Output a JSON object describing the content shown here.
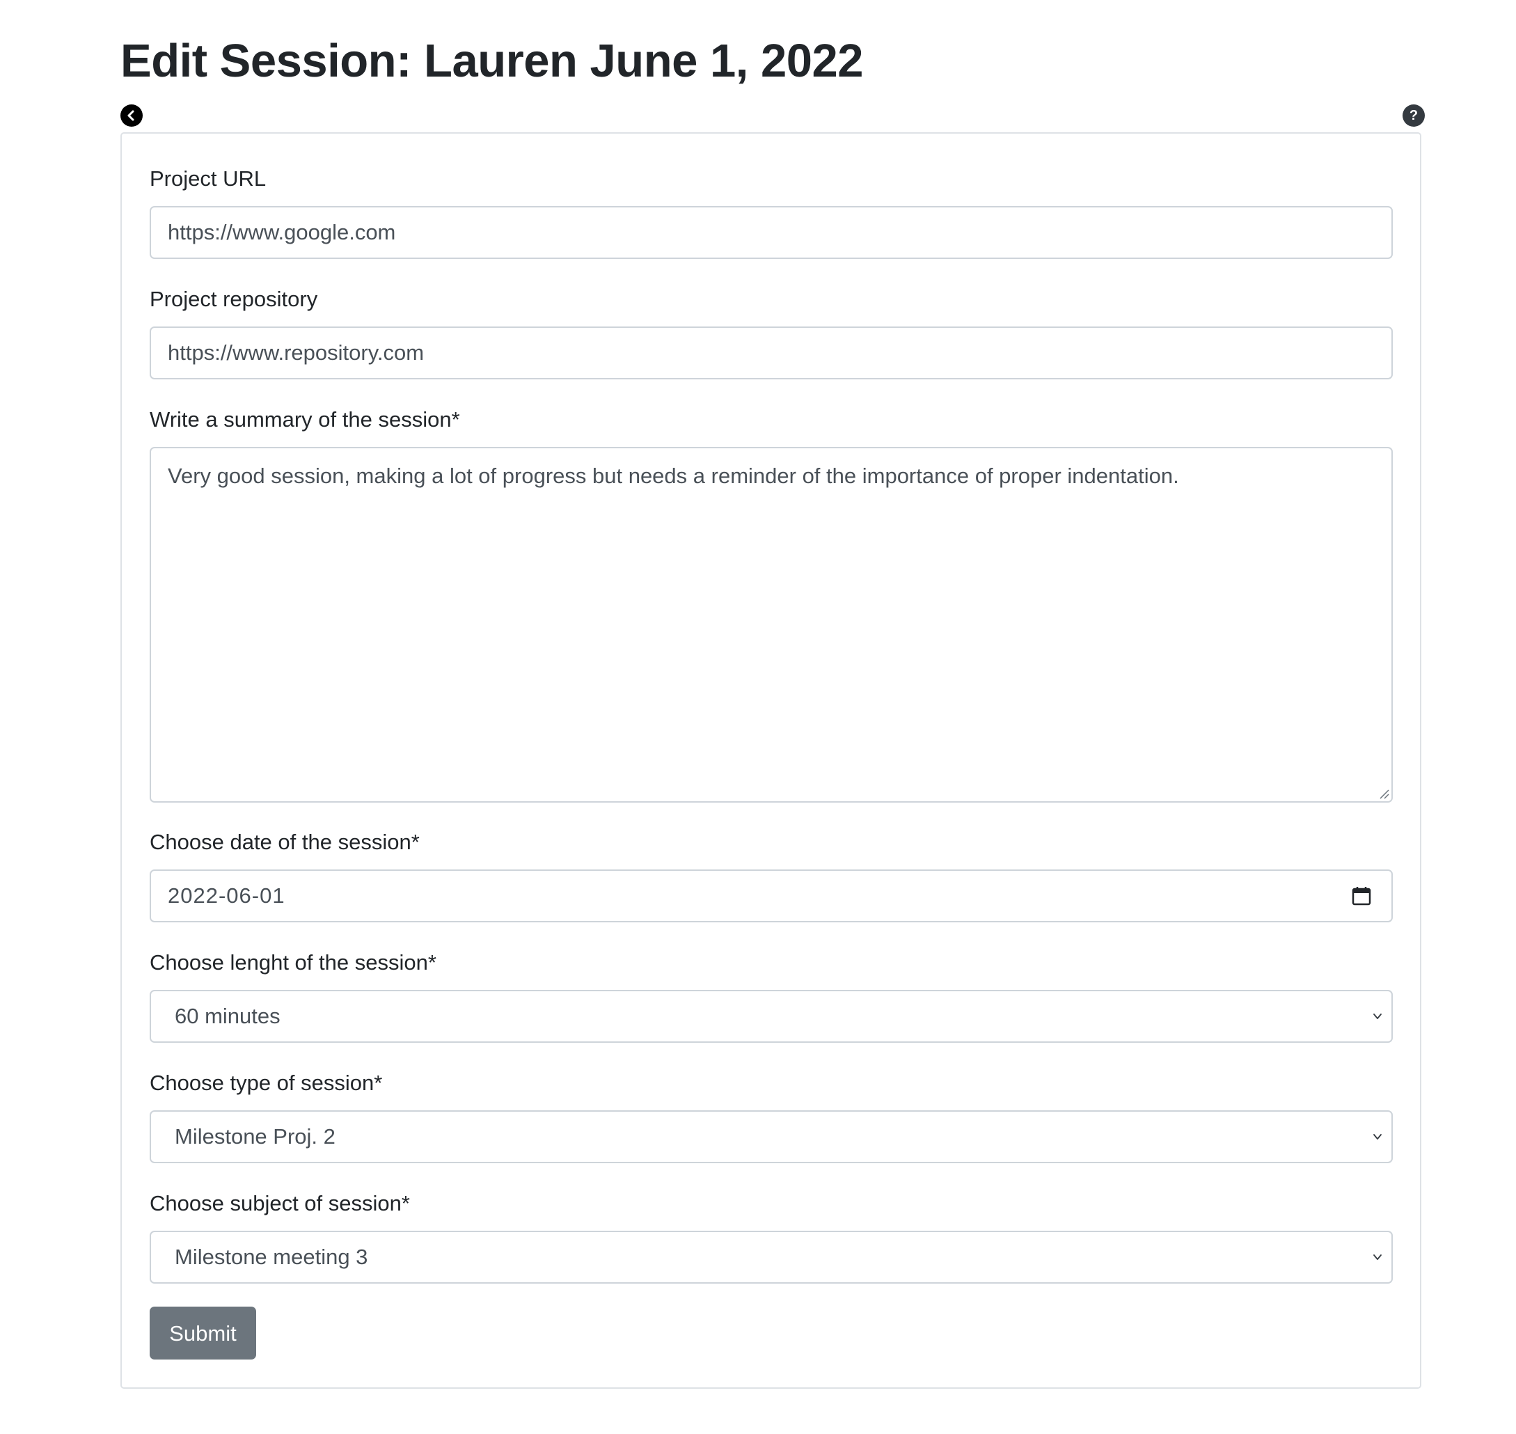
{
  "page": {
    "title": "Edit Session: Lauren June 1, 2022"
  },
  "icons": {
    "back": "chevron-left-icon",
    "help": "question-icon",
    "help_glyph": "?"
  },
  "form": {
    "project_url": {
      "label": "Project URL",
      "value": "https://www.google.com"
    },
    "project_repository": {
      "label": "Project repository",
      "value": "https://www.repository.com"
    },
    "summary": {
      "label": "Write a summary of the session*",
      "value": "Very good session, making a lot of progress but needs a reminder of the importance of proper indentation."
    },
    "date": {
      "label": "Choose date of the session*",
      "value": "2022-06-01"
    },
    "length": {
      "label": "Choose lenght of the session*",
      "selected": "60 minutes"
    },
    "type": {
      "label": "Choose type of session*",
      "selected": "Milestone Proj. 2"
    },
    "subject": {
      "label": "Choose subject of session*",
      "selected": "Milestone meeting 3"
    },
    "submit_label": "Submit"
  },
  "colors": {
    "submit_bg": "#6c757d",
    "border": "#ced4da",
    "text": "#212529",
    "input_text": "#495057"
  }
}
